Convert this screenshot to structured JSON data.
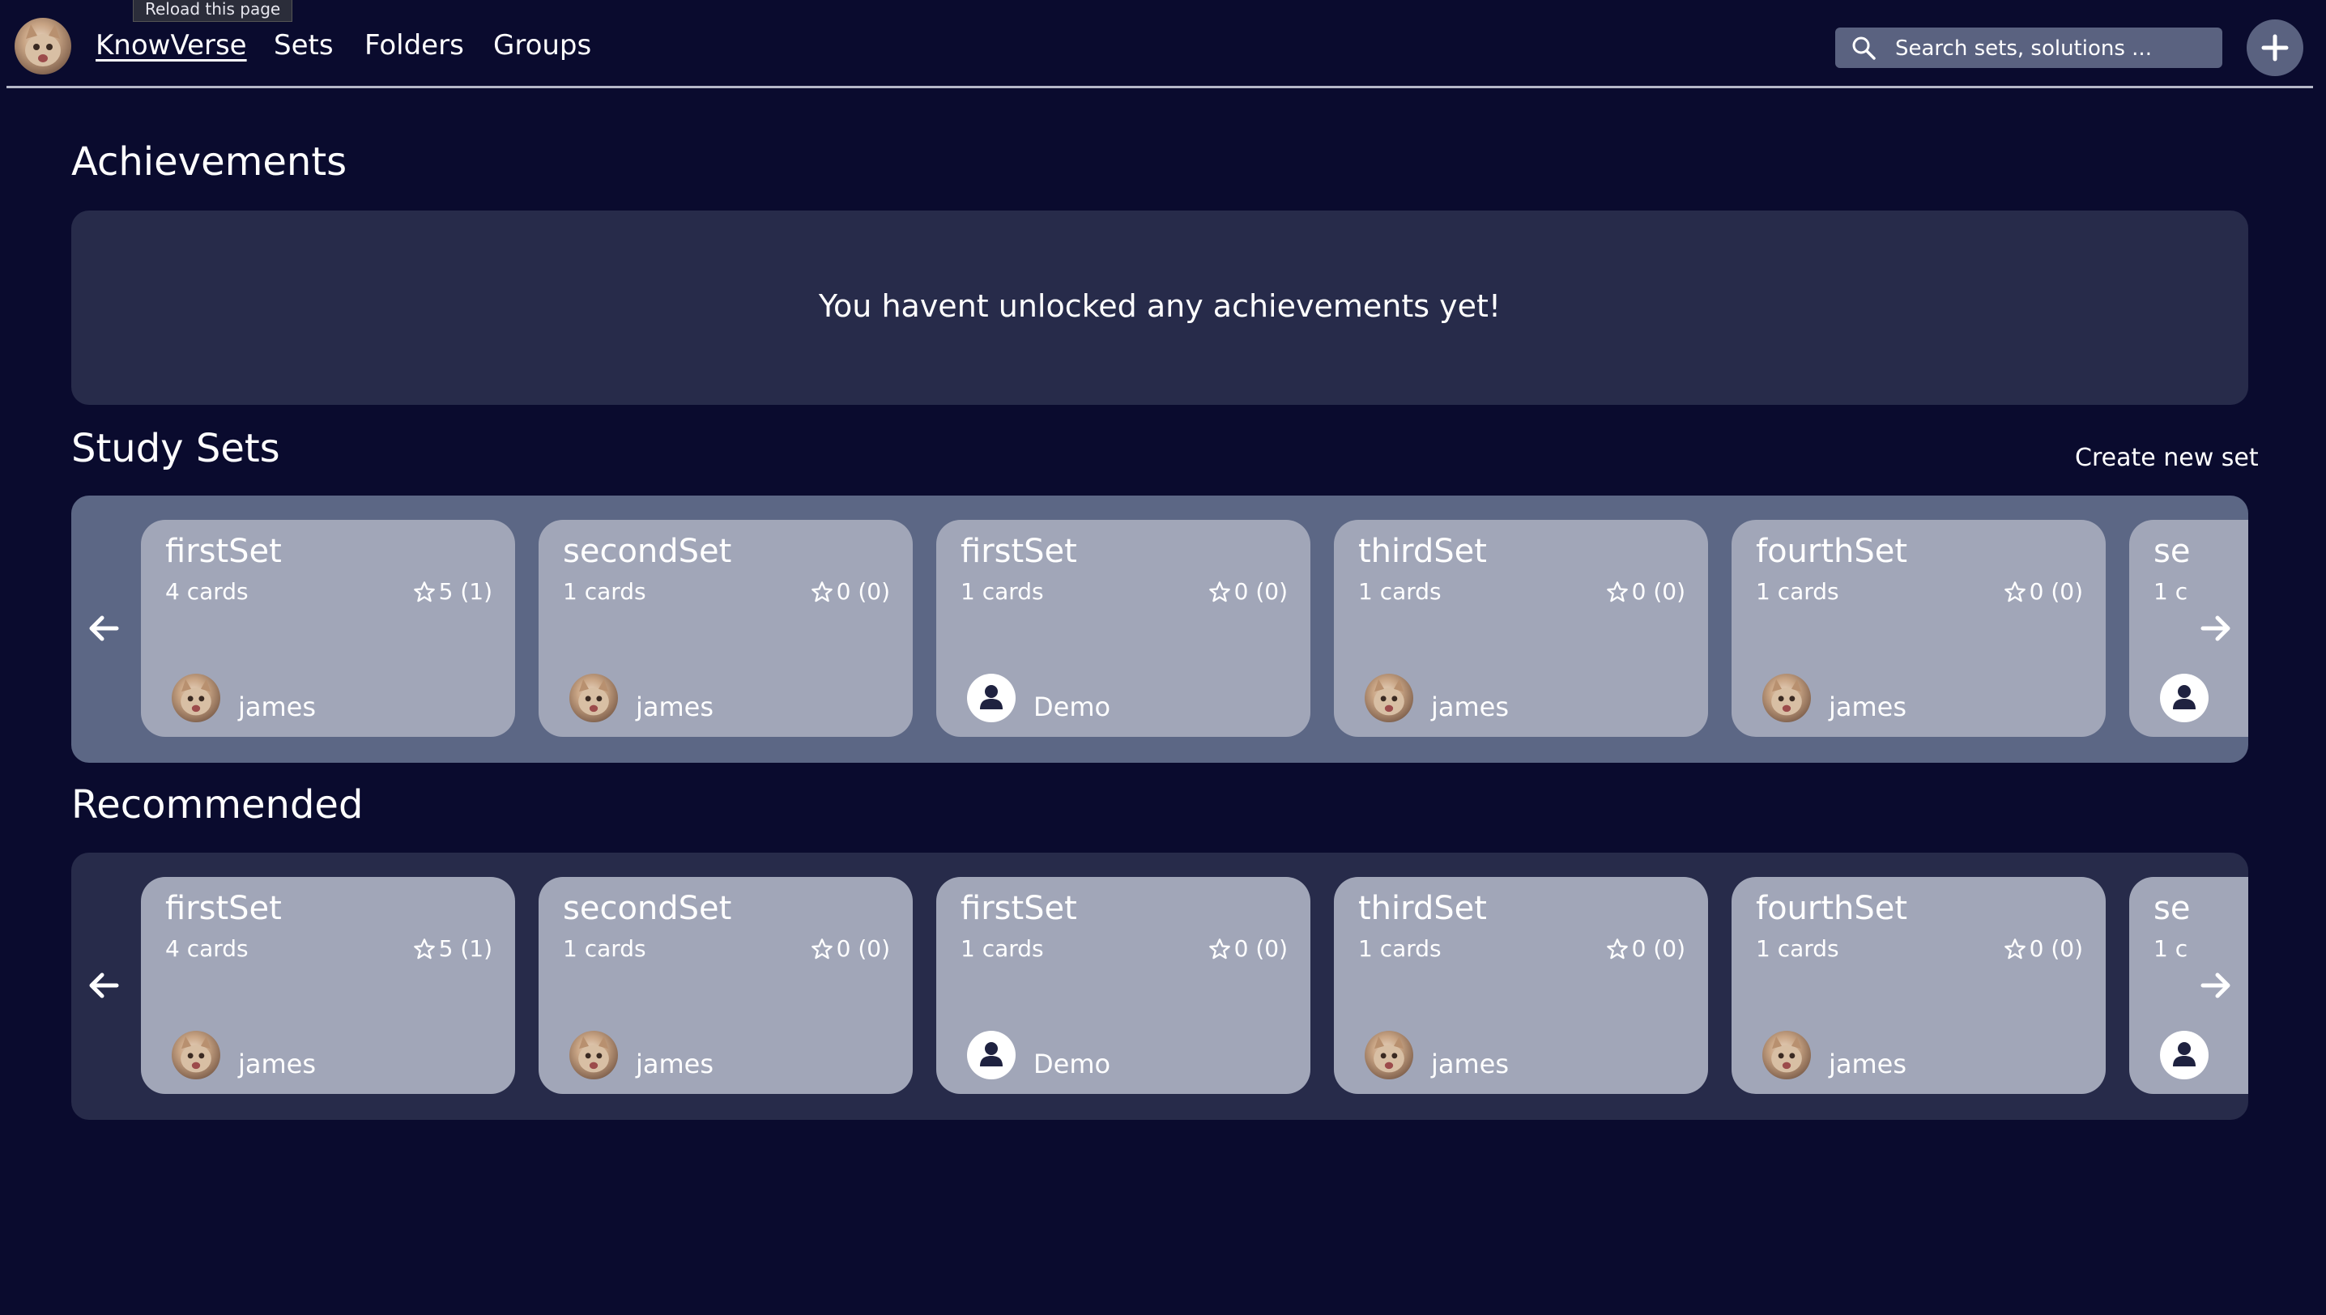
{
  "tooltip": "Reload this page",
  "nav": {
    "brand": "KnowVerse",
    "links": [
      "Sets",
      "Folders",
      "Groups"
    ],
    "search_placeholder": "Search sets, solutions ..."
  },
  "achievements": {
    "title": "Achievements",
    "empty_message": "You havent unlocked any achievements yet!"
  },
  "study_sets": {
    "title": "Study Sets",
    "create_label": "Create new set",
    "cards": [
      {
        "title": "firstSet",
        "count": "4 cards",
        "rating": "5 (1)",
        "author": "james",
        "avatar": "cat"
      },
      {
        "title": "secondSet",
        "count": "1 cards",
        "rating": "0 (0)",
        "author": "james",
        "avatar": "cat"
      },
      {
        "title": "firstSet",
        "count": "1 cards",
        "rating": "0 (0)",
        "author": "Demo",
        "avatar": "person"
      },
      {
        "title": "thirdSet",
        "count": "1 cards",
        "rating": "0 (0)",
        "author": "james",
        "avatar": "cat"
      },
      {
        "title": "fourthSet",
        "count": "1 cards",
        "rating": "0 (0)",
        "author": "james",
        "avatar": "cat"
      },
      {
        "title": "se",
        "count": "1 c",
        "rating": "",
        "author": "",
        "avatar": "person"
      }
    ]
  },
  "recommended": {
    "title": "Recommended",
    "cards": [
      {
        "title": "firstSet",
        "count": "4 cards",
        "rating": "5 (1)",
        "author": "james",
        "avatar": "cat"
      },
      {
        "title": "secondSet",
        "count": "1 cards",
        "rating": "0 (0)",
        "author": "james",
        "avatar": "cat"
      },
      {
        "title": "firstSet",
        "count": "1 cards",
        "rating": "0 (0)",
        "author": "Demo",
        "avatar": "person"
      },
      {
        "title": "thirdSet",
        "count": "1 cards",
        "rating": "0 (0)",
        "author": "james",
        "avatar": "cat"
      },
      {
        "title": "fourthSet",
        "count": "1 cards",
        "rating": "0 (0)",
        "author": "james",
        "avatar": "cat"
      },
      {
        "title": "se",
        "count": "1 c",
        "rating": "",
        "author": "",
        "avatar": "person"
      }
    ]
  },
  "colors": {
    "background": "#0a0b2e",
    "panel": "#272b4a",
    "study_panel": "#5c6785",
    "card": "#a1a6b8",
    "search": "#5a6280"
  }
}
